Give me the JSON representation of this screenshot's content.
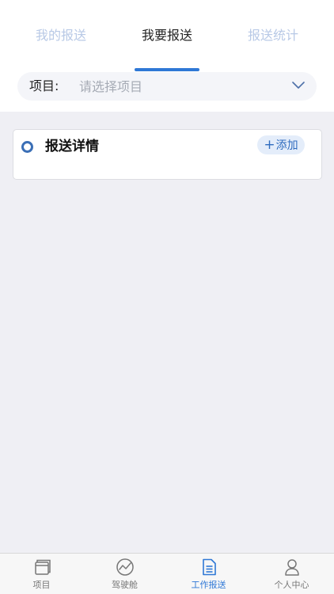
{
  "tabs": {
    "items": [
      {
        "label": "我的报送"
      },
      {
        "label": "我要报送"
      },
      {
        "label": "报送统计"
      }
    ],
    "active_index": 1
  },
  "project_selector": {
    "label": "项目:",
    "placeholder": "请选择项目"
  },
  "detail_card": {
    "title": "报送详情",
    "add_label": "添加",
    "add_symbol": "+"
  },
  "bottom_nav": {
    "items": [
      {
        "label": "项目",
        "icon": "project-icon"
      },
      {
        "label": "驾驶舱",
        "icon": "dashboard-icon"
      },
      {
        "label": "工作报送",
        "icon": "report-document-icon"
      },
      {
        "label": "个人中心",
        "icon": "user-icon"
      }
    ],
    "active_index": 2
  },
  "colors": {
    "accent": "#2f78d6",
    "inactive_tab": "#b8c9e6",
    "background": "#efeff4"
  }
}
